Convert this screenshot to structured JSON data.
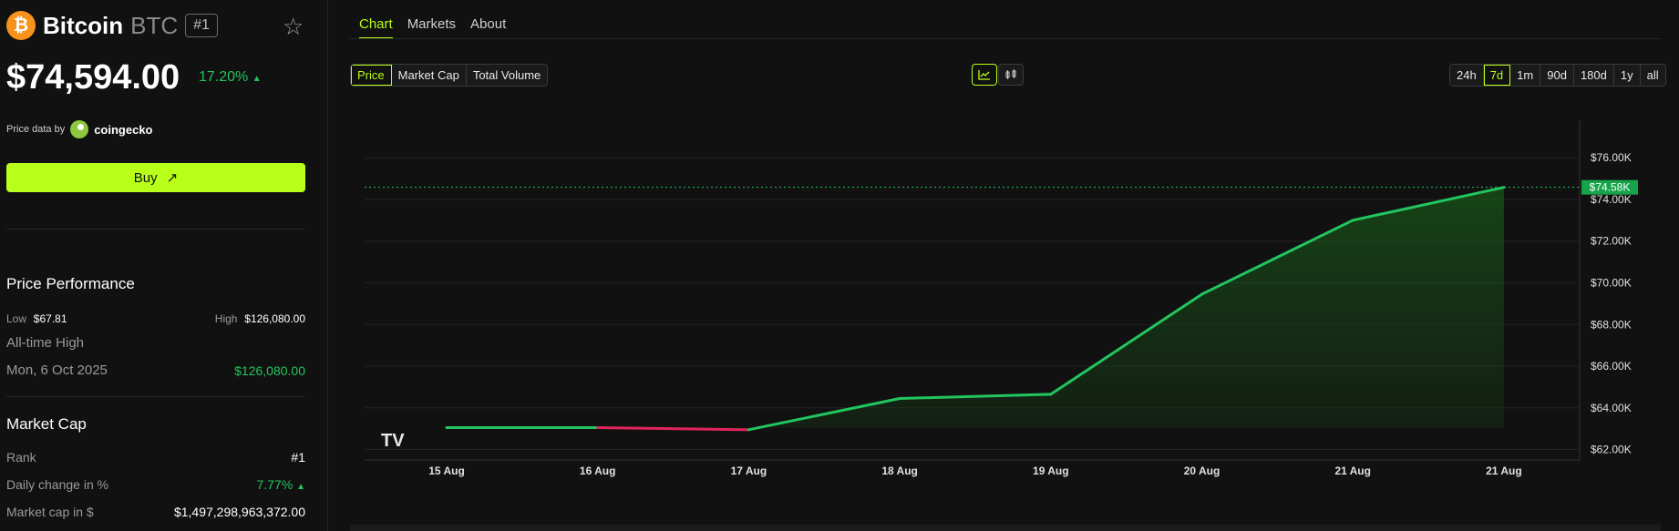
{
  "coin": {
    "name": "Bitcoin",
    "symbol": "BTC",
    "rank_badge": "#1",
    "logo_glyph": "₿",
    "price": "$74,594.00",
    "change": "17.20%",
    "change_arrow": "▲",
    "price_data_by": "Price data by",
    "source": "coingecko"
  },
  "buy": {
    "label": "Buy",
    "icon": "arrow-up-right-icon"
  },
  "performance": {
    "title": "Price Performance",
    "low_label": "Low",
    "low_value": "$67.81",
    "high_label": "High",
    "high_value": "$126,080.00",
    "ath_label": "All-time High",
    "ath_date": "Mon, 6 Oct 2025",
    "ath_value": "$126,080.00"
  },
  "market_cap": {
    "title": "Market Cap",
    "rank_label": "Rank",
    "rank_value": "#1",
    "daily_label": "Daily change in %",
    "daily_value": "7.77%",
    "daily_arrow": "▲",
    "cap_label": "Market cap in $",
    "cap_value": "$1,497,298,963,372.00"
  },
  "tabs": [
    "Chart",
    "Markets",
    "About"
  ],
  "active_tab": "Chart",
  "metrics": [
    "Price",
    "Market Cap",
    "Total Volume"
  ],
  "active_metric": "Price",
  "chart_modes": [
    "line-chart-icon",
    "candlestick-icon"
  ],
  "ranges": [
    "24h",
    "7d",
    "1m",
    "90d",
    "180d",
    "1y",
    "all"
  ],
  "active_range": "7d",
  "colors": {
    "accent": "#b8ff1a",
    "up": "#22c55e",
    "down": "#e0245e",
    "bg": "#111111"
  },
  "chart_data": {
    "type": "area",
    "x": [
      "15 Aug",
      "16 Aug",
      "17 Aug",
      "18 Aug",
      "19 Aug",
      "20 Aug",
      "21 Aug",
      "21 Aug"
    ],
    "values": [
      63050,
      63050,
      62950,
      64450,
      64650,
      69450,
      73000,
      74580
    ],
    "segment_colors": [
      "up",
      "down",
      "up",
      "up",
      "up",
      "up",
      "up"
    ],
    "y_ticks": [
      "$62.00K",
      "$64.00K",
      "$66.00K",
      "$68.00K",
      "$70.00K",
      "$72.00K",
      "$74.00K",
      "$76.00K"
    ],
    "ylim": [
      61500,
      77800
    ],
    "current_label": "$74.58K",
    "current_value": 74580,
    "grid": true,
    "watermark": "TV"
  }
}
